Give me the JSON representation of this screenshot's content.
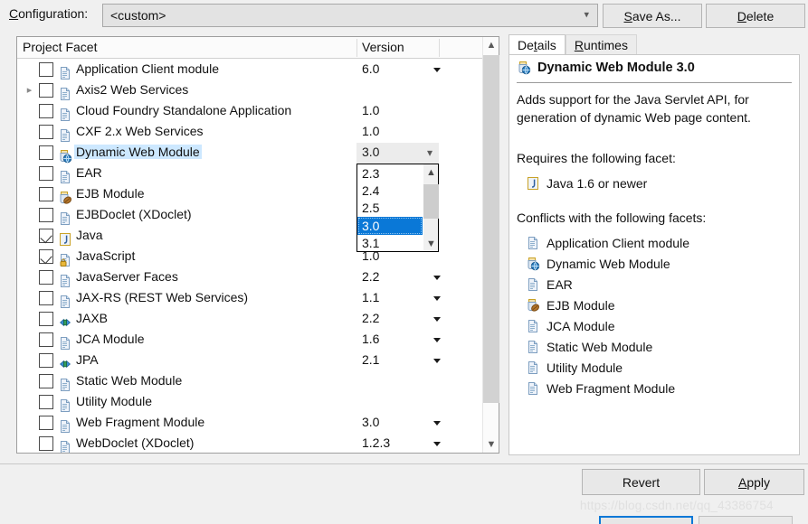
{
  "config": {
    "label": "Configuration:",
    "label_accel": "C",
    "value": "<custom>",
    "save_as_label": "Save As...",
    "save_as_accel": "S",
    "delete_label": "Delete",
    "delete_accel": "D"
  },
  "table": {
    "columns": [
      "Project Facet",
      "Version"
    ],
    "rows": [
      {
        "label": "Application Client module",
        "icon": "doc-icon",
        "checked": false,
        "expandable": false,
        "version": "6.0",
        "has_caret": true,
        "selected": false
      },
      {
        "label": "Axis2 Web Services",
        "icon": "doc-icon",
        "checked": false,
        "expandable": true,
        "version": "",
        "has_caret": false,
        "selected": false
      },
      {
        "label": "Cloud Foundry Standalone Application",
        "icon": "doc-icon",
        "checked": false,
        "expandable": false,
        "version": "1.0",
        "has_caret": false,
        "selected": false
      },
      {
        "label": "CXF 2.x Web Services",
        "icon": "doc-icon",
        "checked": false,
        "expandable": false,
        "version": "1.0",
        "has_caret": false,
        "selected": false
      },
      {
        "label": "Dynamic Web Module",
        "icon": "web-module-icon",
        "checked": false,
        "expandable": false,
        "version": "3.0",
        "has_caret": false,
        "selected": true
      },
      {
        "label": "EAR",
        "icon": "doc-icon",
        "checked": false,
        "expandable": false,
        "version": "",
        "has_caret": false,
        "selected": false
      },
      {
        "label": "EJB Module",
        "icon": "ejb-icon",
        "checked": false,
        "expandable": false,
        "version": "",
        "has_caret": false,
        "selected": false
      },
      {
        "label": "EJBDoclet (XDoclet)",
        "icon": "doc-icon",
        "checked": false,
        "expandable": false,
        "version": "",
        "has_caret": false,
        "selected": false
      },
      {
        "label": "Java",
        "icon": "java-icon",
        "checked": true,
        "expandable": false,
        "version": "",
        "has_caret": false,
        "selected": false
      },
      {
        "label": "JavaScript",
        "icon": "javascript-icon",
        "checked": true,
        "expandable": false,
        "version": "1.0",
        "has_caret": false,
        "selected": false
      },
      {
        "label": "JavaServer Faces",
        "icon": "doc-icon",
        "checked": false,
        "expandable": false,
        "version": "2.2",
        "has_caret": true,
        "selected": false
      },
      {
        "label": "JAX-RS (REST Web Services)",
        "icon": "doc-icon",
        "checked": false,
        "expandable": false,
        "version": "1.1",
        "has_caret": true,
        "selected": false
      },
      {
        "label": "JAXB",
        "icon": "arrows-icon",
        "checked": false,
        "expandable": false,
        "version": "2.2",
        "has_caret": true,
        "selected": false
      },
      {
        "label": "JCA Module",
        "icon": "doc-icon",
        "checked": false,
        "expandable": false,
        "version": "1.6",
        "has_caret": true,
        "selected": false
      },
      {
        "label": "JPA",
        "icon": "arrows-icon",
        "checked": false,
        "expandable": false,
        "version": "2.1",
        "has_caret": true,
        "selected": false
      },
      {
        "label": "Static Web Module",
        "icon": "doc-icon",
        "checked": false,
        "expandable": false,
        "version": "",
        "has_caret": false,
        "selected": false
      },
      {
        "label": "Utility Module",
        "icon": "doc-icon",
        "checked": false,
        "expandable": false,
        "version": "",
        "has_caret": false,
        "selected": false
      },
      {
        "label": "Web Fragment Module",
        "icon": "doc-icon",
        "checked": false,
        "expandable": false,
        "version": "3.0",
        "has_caret": true,
        "selected": false
      },
      {
        "label": "WebDoclet (XDoclet)",
        "icon": "doc-icon",
        "checked": false,
        "expandable": false,
        "version": "1.2.3",
        "has_caret": true,
        "selected": false
      }
    ]
  },
  "version_dropdown": {
    "open": true,
    "current": "3.0",
    "options": [
      "2.3",
      "2.4",
      "2.5",
      "3.0",
      "3.1"
    ],
    "selected": "3.0"
  },
  "details": {
    "tabs": [
      {
        "label": "Details",
        "accel": "t",
        "active": true
      },
      {
        "label": "Runtimes",
        "accel": "R",
        "active": false
      }
    ],
    "title": "Dynamic Web Module 3.0",
    "title_icon": "web-module-icon",
    "description": "Adds support for the Java Servlet API, for generation of dynamic Web page content.",
    "requires_heading": "Requires the following facet:",
    "requires": [
      {
        "label": "Java 1.6 or newer",
        "icon": "java-icon"
      }
    ],
    "conflicts_heading": "Conflicts with the following facets:",
    "conflicts": [
      {
        "label": "Application Client module",
        "icon": "doc-icon"
      },
      {
        "label": "Dynamic Web Module",
        "icon": "web-module-icon"
      },
      {
        "label": "EAR",
        "icon": "doc-icon"
      },
      {
        "label": "EJB Module",
        "icon": "ejb-icon"
      },
      {
        "label": "JCA Module",
        "icon": "doc-icon"
      },
      {
        "label": "Static Web Module",
        "icon": "doc-icon"
      },
      {
        "label": "Utility Module",
        "icon": "doc-icon"
      },
      {
        "label": "Web Fragment Module",
        "icon": "doc-icon"
      }
    ]
  },
  "footer": {
    "revert_label": "Revert",
    "apply_label": "Apply",
    "apply_accel": "A"
  },
  "watermark": "https://blog.csdn.net/qq_43386754",
  "colors": {
    "selection_blue": "#0a78d7",
    "row_highlight": "#cde8ff",
    "window_bg": "#f0f0f0"
  }
}
